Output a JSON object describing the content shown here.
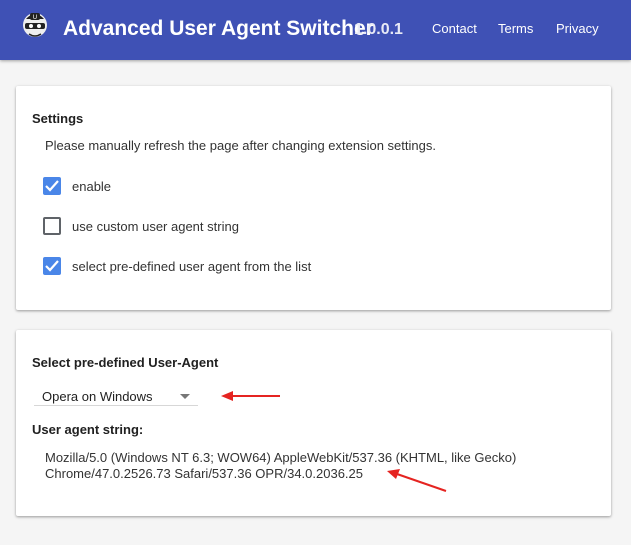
{
  "header": {
    "title": "Advanced User Agent Switcher",
    "version": "1.0.0.1",
    "nav": [
      "Contact",
      "Terms",
      "Privacy"
    ],
    "color": "#3f51b5"
  },
  "settings": {
    "heading": "Settings",
    "note": "Please manually refresh the page after changing extension settings.",
    "options": [
      {
        "label": "enable",
        "checked": true
      },
      {
        "label": "use custom user agent string",
        "checked": false
      },
      {
        "label": "select pre-defined user agent from the list",
        "checked": true
      }
    ]
  },
  "predefined": {
    "heading": "Select pre-defined User-Agent",
    "selected": "Opera on Windows",
    "ua_heading": "User agent string:",
    "ua_line1": "Mozilla/5.0 (Windows NT 6.3; WOW64) AppleWebKit/537.36 (KHTML, like Gecko)",
    "ua_line2": "Chrome/47.0.2526.73 Safari/537.36 OPR/34.0.2036.25"
  },
  "colors": {
    "checkbox": "#4a86e8",
    "annotation_arrow": "#e52421"
  }
}
